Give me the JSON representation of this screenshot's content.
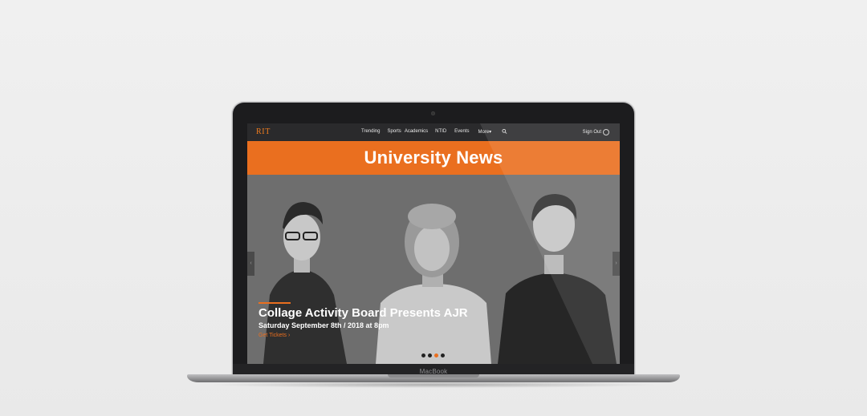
{
  "site": {
    "logo": "RIT",
    "nav_items": [
      "Trending",
      "Sports",
      "Academics",
      "NTID",
      "Events",
      "More▾"
    ],
    "sign_out": "Sign Out"
  },
  "banner": {
    "title": "University News"
  },
  "hero": {
    "title": "Collage Activity Board Presents AJR",
    "date": "Saturday September 8th / 2018 at 8pm",
    "link": "Get Tickets ›",
    "slide_count": 4,
    "active_slide": 3
  },
  "device": {
    "label": "MacBook"
  },
  "colors": {
    "accent": "#ea6f1f",
    "nav_bg": "#2a2a2c"
  },
  "icons": [
    "search-icon",
    "user-icon",
    "chevron-left-icon",
    "chevron-right-icon"
  ]
}
